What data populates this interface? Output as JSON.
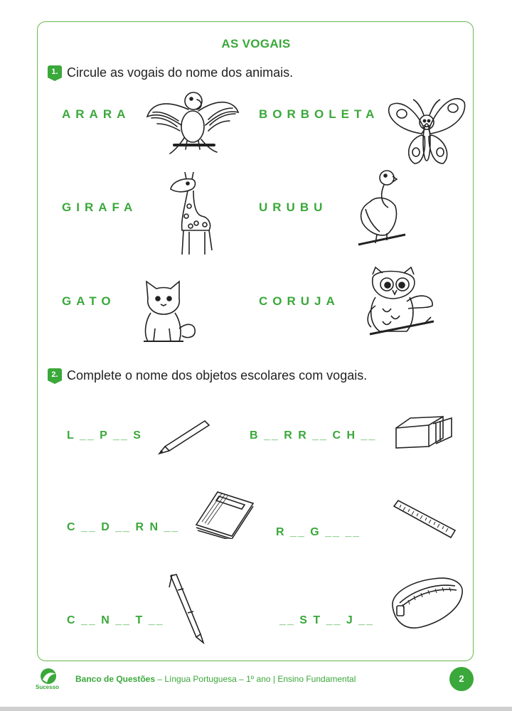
{
  "title": "AS VOGAIS",
  "q1": {
    "number": "1.",
    "text": "Circule as vogais do nome dos animais."
  },
  "animals": [
    {
      "word": "ARARA",
      "icon": "parrot-icon"
    },
    {
      "word": "BORBOLETA",
      "icon": "butterfly-icon"
    },
    {
      "word": "GIRAFA",
      "icon": "giraffe-icon"
    },
    {
      "word": "URUBU",
      "icon": "vulture-icon"
    },
    {
      "word": "GATO",
      "icon": "cat-icon"
    },
    {
      "word": "CORUJA",
      "icon": "owl-icon"
    }
  ],
  "q2": {
    "number": "2.",
    "text": "Complete o nome dos objetos escolares com vogais."
  },
  "objects": [
    {
      "blank": "L __ P __ S",
      "icon": "pencil-icon"
    },
    {
      "blank": "B __ R R __ C H __",
      "icon": "eraser-icon"
    },
    {
      "blank": "C __ D __ R N __",
      "icon": "notebook-icon"
    },
    {
      "blank": "R __ G __ __",
      "icon": "ruler-icon"
    },
    {
      "blank": "C __ N __ T __",
      "icon": "pen-icon"
    },
    {
      "blank": "__ S T __ J __",
      "icon": "pencil-case-icon"
    }
  ],
  "footer": {
    "brand": "Sucesso",
    "series": "Banco de Questões",
    "subtitle": " – Língua Portuguesa – 1º ano | Ensino Fundamental",
    "page": "2"
  },
  "colors": {
    "accent": "#3aa83a",
    "frame": "#6ab84f"
  }
}
